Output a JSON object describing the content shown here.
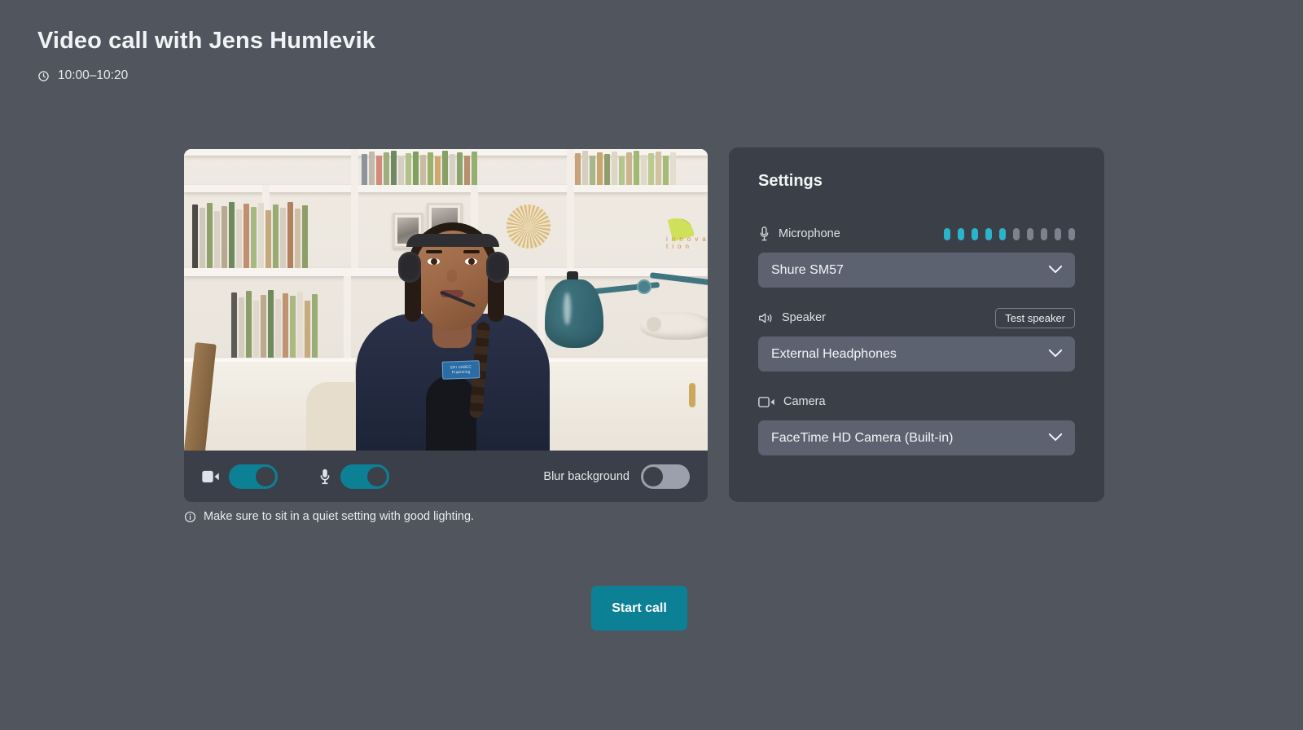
{
  "header": {
    "title": "Video call with Jens Humlevik",
    "time": "10:00–10:20",
    "clock_icon": "clock-icon"
  },
  "video": {
    "controls": {
      "camera": {
        "icon": "video-camera-icon",
        "state": "on",
        "label": "Camera"
      },
      "microphone": {
        "icon": "microphone-icon",
        "state": "on",
        "label": "Microphone"
      },
      "blur_background": {
        "label": "Blur background",
        "state": "off"
      }
    },
    "badge_line1": "SRI VABEC",
    "badge_line2": "Praktising"
  },
  "note": {
    "icon": "info-circle-icon",
    "text": "Make sure to sit in a quiet setting with good lighting."
  },
  "settings": {
    "title": "Settings",
    "microphone": {
      "icon": "microphone-icon",
      "label": "Microphone",
      "value": "Shure SM57",
      "level_total": 10,
      "level_active": 5
    },
    "speaker": {
      "icon": "speaker-icon",
      "label": "Speaker",
      "value": "External Headphones",
      "test_button": "Test speaker"
    },
    "camera": {
      "icon": "video-camera-icon",
      "label": "Camera",
      "value": "FaceTime HD Camera (Built-in)"
    }
  },
  "actions": {
    "start_call": "Start call"
  },
  "colors": {
    "background": "#50555e",
    "panel": "#3b4048",
    "control_bar": "#3b3f4a",
    "select": "#5c6270",
    "accent": "#0c8196",
    "meter_on": "#2bb3c9",
    "meter_off": "#7c838f",
    "toggle_off": "#9aa1ac"
  }
}
